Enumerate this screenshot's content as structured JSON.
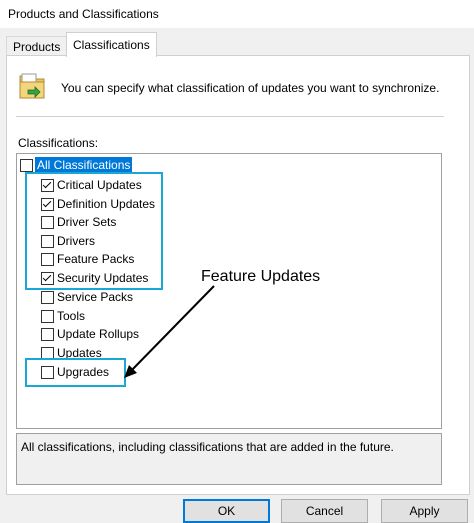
{
  "window": {
    "title": "Products and Classifications"
  },
  "tabs": [
    {
      "label": "Products"
    },
    {
      "label": "Classifications"
    }
  ],
  "info": {
    "text": "You can specify what classification of updates you want to synchronize."
  },
  "classifications_label": "Classifications:",
  "items": [
    {
      "label": "All Classifications",
      "checked": false
    },
    {
      "label": "Critical Updates",
      "checked": true
    },
    {
      "label": "Definition Updates",
      "checked": true
    },
    {
      "label": "Driver Sets",
      "checked": false
    },
    {
      "label": "Drivers",
      "checked": false
    },
    {
      "label": "Feature Packs",
      "checked": false
    },
    {
      "label": "Security Updates",
      "checked": true
    },
    {
      "label": "Service Packs",
      "checked": false
    },
    {
      "label": "Tools",
      "checked": false
    },
    {
      "label": "Update Rollups",
      "checked": false
    },
    {
      "label": "Updates",
      "checked": false
    },
    {
      "label": "Upgrades",
      "checked": false
    }
  ],
  "annotation": "Feature Updates",
  "description": "All classifications, including classifications that are added in the future.",
  "buttons": {
    "ok": "OK",
    "cancel": "Cancel",
    "apply": "Apply"
  },
  "colors": {
    "highlight_box": "#1aa6d6",
    "selection": "#0078d7"
  }
}
